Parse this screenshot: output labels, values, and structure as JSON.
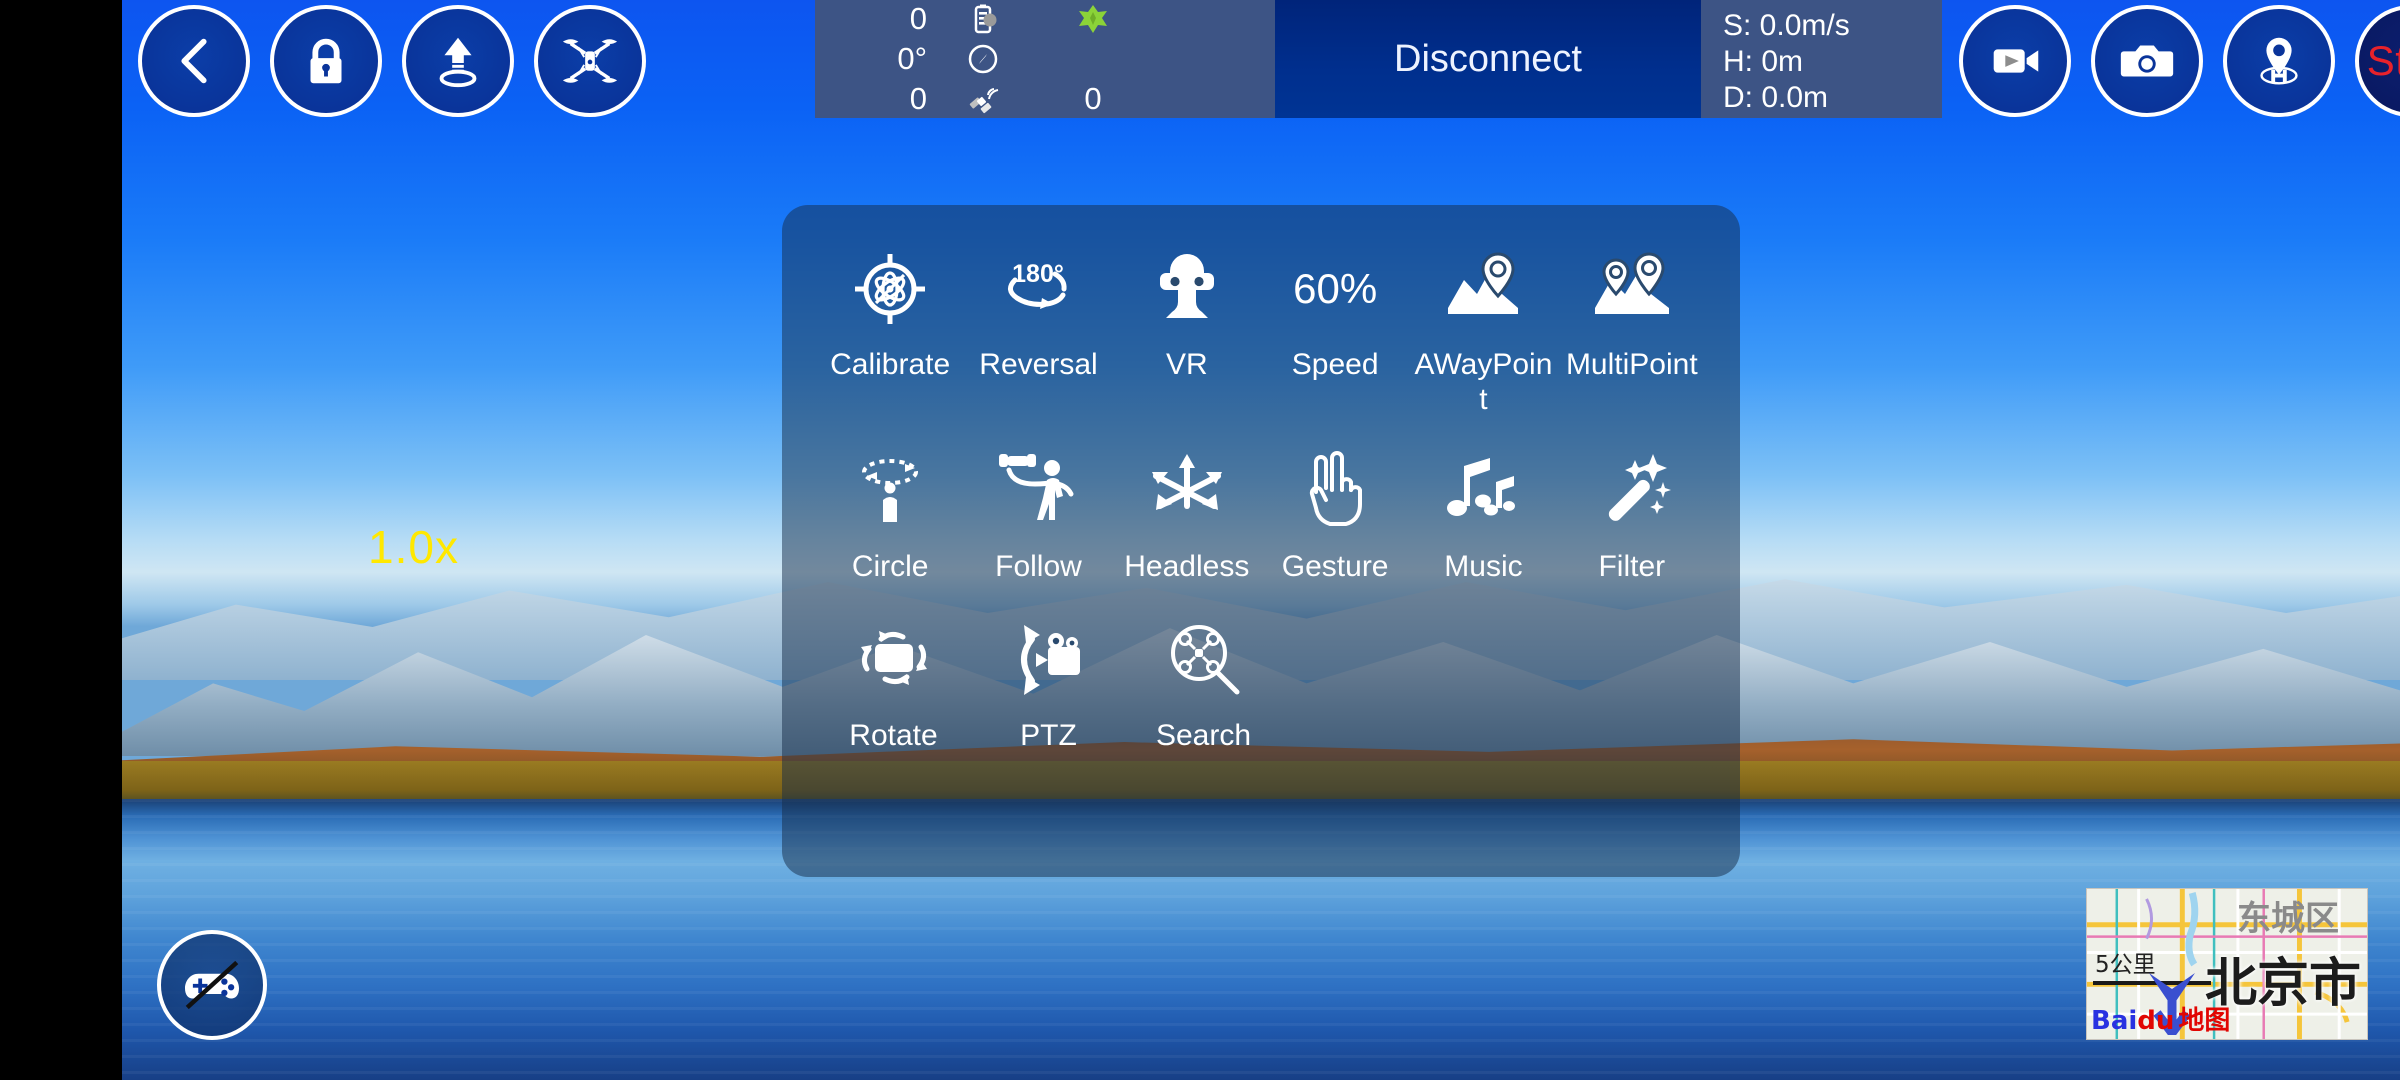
{
  "topbar": {
    "left_buttons": [
      {
        "name": "back-button",
        "icon": "chevron-left-icon",
        "label": "Back"
      },
      {
        "name": "lock-button",
        "icon": "lock-icon",
        "label": "Lock"
      },
      {
        "name": "takeoff-button",
        "icon": "takeoff-arrow-icon",
        "label": "Takeoff"
      },
      {
        "name": "drone-button",
        "icon": "quadcopter-icon",
        "label": "Drone"
      }
    ],
    "right_buttons": [
      {
        "name": "record-video-button",
        "icon": "video-camera-icon",
        "label": "Record"
      },
      {
        "name": "take-photo-button",
        "icon": "photo-camera-icon",
        "label": "Photo"
      },
      {
        "name": "return-home-button",
        "icon": "home-pin-icon",
        "label": "Return Home"
      }
    ],
    "stop_label": "Stop",
    "connection_status": "Disconnect"
  },
  "status": {
    "battery_value": "0",
    "battery_icon": "battery-icon",
    "signal_icon": "signal-star-icon",
    "heading_value": "0°",
    "compass_icon": "compass-icon",
    "satellite_count_left": "0",
    "satellite_icon": "satellite-icon",
    "satellite_count_right": "0"
  },
  "telemetry": {
    "speed": "S: 0.0m/s",
    "height": "H: 0m",
    "distance": "D: 0.0m"
  },
  "overlay": {
    "zoom_level": "1.0x",
    "joystick_icon": "gamepad-disabled-icon"
  },
  "menu": {
    "rows": [
      [
        {
          "label": "Calibrate",
          "icon": "calibrate-target-icon",
          "name": "menu-item-calibrate"
        },
        {
          "label": "Reversal",
          "icon": "reversal-180-icon",
          "name": "menu-item-reversal"
        },
        {
          "label": "VR",
          "icon": "vr-goggles-icon",
          "name": "menu-item-vr"
        },
        {
          "label": "Speed",
          "icon": "speed-percent-text",
          "value": "60%",
          "name": "menu-item-speed"
        },
        {
          "label": "AWayPoint",
          "icon": "waypoint-map-icon",
          "name": "menu-item-awaypoint"
        },
        {
          "label": "MultiPoint",
          "icon": "multipoint-map-icon",
          "name": "menu-item-multipoint"
        }
      ],
      [
        {
          "label": "Circle",
          "icon": "orbit-circle-icon",
          "name": "menu-item-circle"
        },
        {
          "label": "Follow",
          "icon": "follow-me-icon",
          "name": "menu-item-follow"
        },
        {
          "label": "Headless",
          "icon": "headless-arrows-icon",
          "name": "menu-item-headless"
        },
        {
          "label": "Gesture",
          "icon": "hand-gesture-icon",
          "name": "menu-item-gesture"
        },
        {
          "label": "Music",
          "icon": "music-notes-icon",
          "name": "menu-item-music"
        },
        {
          "label": "Filter",
          "icon": "magic-wand-icon",
          "name": "menu-item-filter"
        }
      ],
      [
        {
          "label": "Rotate",
          "icon": "rotate-screen-icon",
          "name": "menu-item-rotate"
        },
        {
          "label": "PTZ",
          "icon": "ptz-camera-icon",
          "name": "menu-item-ptz"
        },
        {
          "label": "Search",
          "icon": "search-drone-icon",
          "name": "menu-item-search"
        }
      ]
    ]
  },
  "minimap": {
    "city": "北京市",
    "district": "东城区",
    "scale": "5公里",
    "logo_part1": "Bai",
    "logo_part2": "du",
    "logo_part3": "地图"
  },
  "colors": {
    "accent_blue": "#0a349a",
    "panel_blue": "#3d5485",
    "center_navy": "#002f8e",
    "stop_red": "#e8222b",
    "zoom_yellow": "#ffe800"
  }
}
